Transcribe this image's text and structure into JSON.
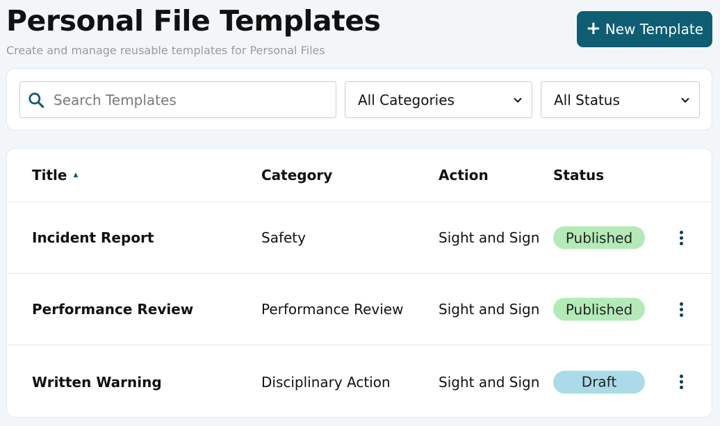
{
  "header": {
    "title": "Personal File Templates",
    "subtitle": "Create and manage reusable templates for Personal Files",
    "new_button_label": "New Template",
    "new_button_icon": "plus-icon",
    "accent_color": "#0e5d73"
  },
  "filters": {
    "search_placeholder": "Search Templates",
    "search_value": "",
    "category_selected": "All Categories",
    "status_selected": "All Status"
  },
  "table": {
    "columns": [
      "Title",
      "Category",
      "Action",
      "Status"
    ],
    "sort_column": "Title",
    "sort_direction": "ascending",
    "rows": [
      {
        "title": "Incident Report",
        "category": "Safety",
        "action": "Sight and Sign",
        "status": "Published"
      },
      {
        "title": "Performance Review",
        "category": "Performance Review",
        "action": "Sight and Sign",
        "status": "Published"
      },
      {
        "title": "Written Warning",
        "category": "Disciplinary Action",
        "action": "Sight and Sign",
        "status": "Draft"
      }
    ]
  },
  "status_colors": {
    "Published": "#b4eab7",
    "Draft": "#abdbe8"
  }
}
